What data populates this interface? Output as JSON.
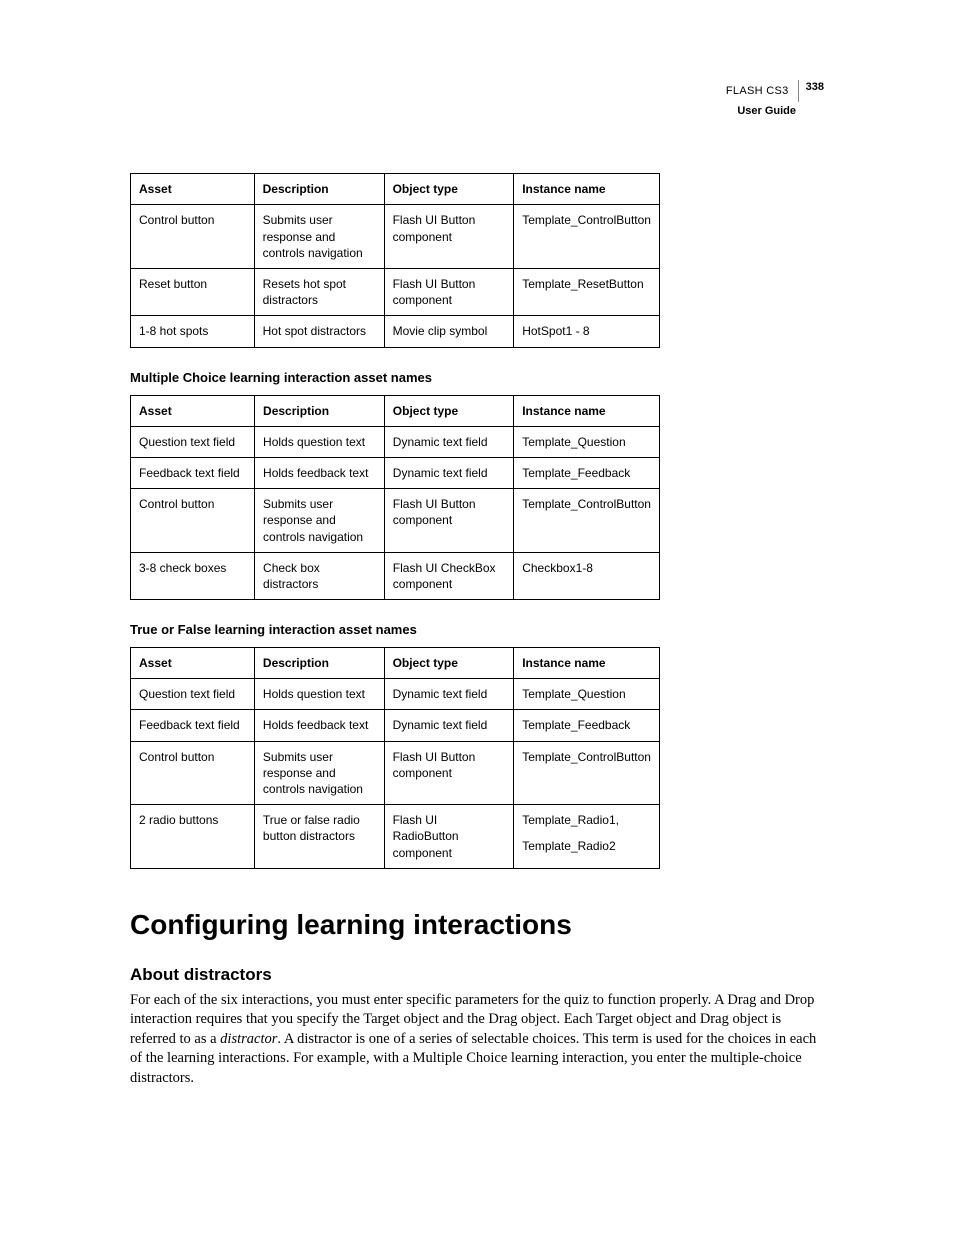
{
  "header": {
    "product": "FLASH CS3",
    "page_number": "338",
    "guide_label": "User Guide"
  },
  "table1": {
    "cols": [
      "Asset",
      "Description",
      "Object type",
      "Instance name"
    ],
    "rows": [
      [
        "Control button",
        "Submits user response and controls navigation",
        "Flash UI Button component",
        "Template_ControlButton"
      ],
      [
        "Reset button",
        "Resets hot spot distractors",
        "Flash UI Button component",
        "Template_ResetButton"
      ],
      [
        "1-8 hot spots",
        "Hot spot distractors",
        "Movie clip symbol",
        "HotSpot1 - 8"
      ]
    ]
  },
  "subhead2": "Multiple Choice learning interaction asset names",
  "table2": {
    "cols": [
      "Asset",
      "Description",
      "Object type",
      "Instance name"
    ],
    "rows": [
      [
        "Question text field",
        "Holds question text",
        "Dynamic text field",
        "Template_Question"
      ],
      [
        "Feedback text field",
        "Holds feedback text",
        "Dynamic text field",
        "Template_Feedback"
      ],
      [
        "Control button",
        "Submits user response and controls navigation",
        "Flash UI Button component",
        "Template_ControlButton"
      ],
      [
        "3-8 check boxes",
        "Check box distractors",
        "Flash UI CheckBox component",
        "Checkbox1-8"
      ]
    ]
  },
  "subhead3": "True or False learning interaction asset names",
  "table3": {
    "cols": [
      "Asset",
      "Description",
      "Object type",
      "Instance name"
    ],
    "rows": [
      [
        "Question text field",
        "Holds question text",
        "Dynamic text field",
        "Template_Question"
      ],
      [
        "Feedback text field",
        "Holds feedback text",
        "Dynamic text field",
        "Template_Feedback"
      ],
      [
        "Control button",
        "Submits user response and controls navigation",
        "Flash UI Button component",
        "Template_ControlButton"
      ]
    ],
    "lastrow": {
      "asset": "2 radio buttons",
      "description": "True or false radio button distractors",
      "object_type": "Flash UI RadioButton component",
      "instance1": "Template_Radio1,",
      "instance2": "Template_Radio2"
    }
  },
  "section_title": "Configuring learning interactions",
  "topic_head": "About distractors",
  "body_pre": "For each of the six interactions, you must enter specific parameters for the quiz to function properly. A Drag and Drop interaction requires that you specify the Target object and the Drag object. Each Target object and Drag object is referred to as a ",
  "body_ital": "distractor",
  "body_post": ". A distractor is one of a series of selectable choices. This term is used for the choices in each of the learning interactions. For example, with a Multiple Choice learning interaction, you enter the multiple-choice distractors."
}
